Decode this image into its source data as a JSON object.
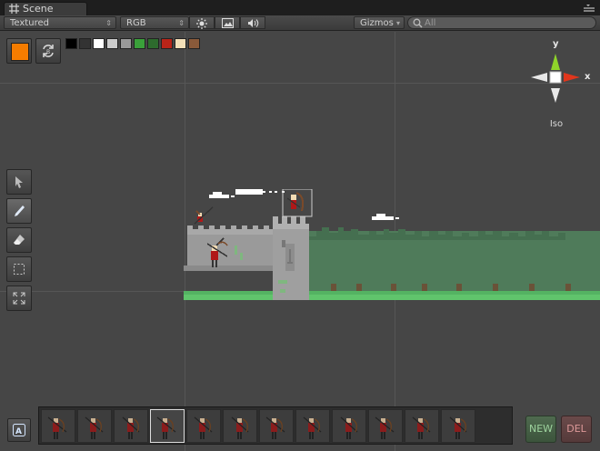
{
  "tab": {
    "label": "Scene",
    "icon": "grid-icon"
  },
  "toolbar": {
    "render_mode": "Textured",
    "color_mode": "RGB",
    "lighting_icon": "sun-icon",
    "image_icon": "image-icon",
    "audio_icon": "speaker-icon",
    "gizmos": "Gizmos",
    "search_placeholder": "All"
  },
  "palette": {
    "active_color": "#f57c00",
    "swatches": [
      "#000000",
      "#333333",
      "#ffffff",
      "#cccccc",
      "#999999",
      "#3aa03a",
      "#2d6b2d",
      "#b82418",
      "#f2dfb8",
      "#8a5a3a"
    ]
  },
  "gizmo": {
    "y_label": "y",
    "x_label": "x",
    "projection": "Iso"
  },
  "tools": [
    "select-tool",
    "pencil-tool",
    "eraser-tool",
    "marquee-tool",
    "expand-tool"
  ],
  "frames": {
    "count": 12,
    "selected_index": 3
  },
  "buttons": {
    "new": "NEW",
    "del": "DEL"
  }
}
